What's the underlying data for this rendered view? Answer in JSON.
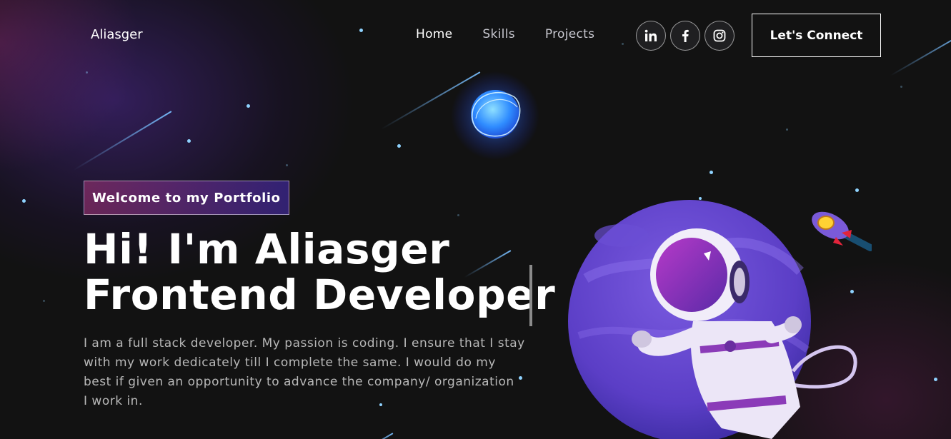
{
  "brand": {
    "name": "Aliasger"
  },
  "nav": {
    "links": [
      {
        "label": "Home"
      },
      {
        "label": "Skills"
      },
      {
        "label": "Projects"
      }
    ],
    "social": [
      {
        "icon": "linkedin-icon"
      },
      {
        "icon": "facebook-icon"
      },
      {
        "icon": "instagram-icon"
      }
    ],
    "connect_label": "Let's Connect"
  },
  "hero": {
    "badge": "Welcome to my Portfolio",
    "title_line1": "Hi! I'm Aliasger",
    "title_line2": "Frontend Developer",
    "description_lines": [
      "I am a full stack developer. My passion is coding. I ensure that I stay",
      "with my work dedicately till I complete the same. I would do my",
      "best if given an opportunity to advance the company/ organization",
      "I work in."
    ]
  },
  "colors": {
    "background": "#121212",
    "accent_purple": "#8a4fd4",
    "badge_gradient_start": "#aa367c",
    "badge_gradient_end": "#4a2fbd",
    "text_muted": "#b8b8b8"
  }
}
